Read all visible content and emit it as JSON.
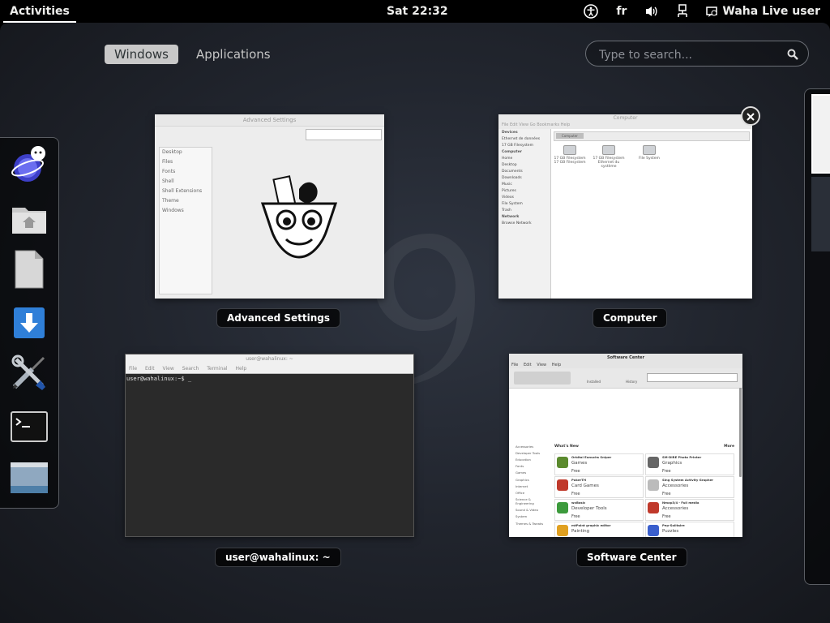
{
  "topbar": {
    "activities": "Activities",
    "clock": "Sat 22:32",
    "keyboard_layout": "fr",
    "user": "Waha Live user"
  },
  "view_switcher": {
    "windows": "Windows",
    "applications": "Applications"
  },
  "search": {
    "placeholder": "Type to search..."
  },
  "windows": {
    "advanced_settings": {
      "caption": "Advanced Settings",
      "title": "Advanced Settings",
      "sidebar": [
        "Desktop",
        "Files",
        "Fonts",
        "Shell",
        "Shell Extensions",
        "Theme",
        "Windows"
      ]
    },
    "computer": {
      "caption": "Computer",
      "title": "Computer",
      "menu": "File  Edit  View  Go  Bookmarks  Help",
      "path_button": "Computer",
      "sidebar": [
        {
          "text": "Devices",
          "h": true
        },
        {
          "text": "Ethernet de données",
          "h": false
        },
        {
          "text": "17 GB Filesystem",
          "h": false
        },
        {
          "text": "Computer",
          "h": true
        },
        {
          "text": "Home",
          "h": false
        },
        {
          "text": "Desktop",
          "h": false
        },
        {
          "text": "Documents",
          "h": false
        },
        {
          "text": "Downloads",
          "h": false
        },
        {
          "text": "Music",
          "h": false
        },
        {
          "text": "Pictures",
          "h": false
        },
        {
          "text": "Videos",
          "h": false
        },
        {
          "text": "File System",
          "h": false
        },
        {
          "text": "Trash",
          "h": false
        },
        {
          "text": "Network",
          "h": true
        },
        {
          "text": "Browse Network",
          "h": false
        }
      ],
      "drives": [
        {
          "label": "17 GB Filesystem 17 GB Filesystem"
        },
        {
          "label": "17 GB Filesystem Ethernet du système"
        },
        {
          "label": "File System"
        }
      ]
    },
    "terminal": {
      "caption": "user@wahalinux: ~",
      "title": "user@wahalinux: ~",
      "menu": [
        "File",
        "Edit",
        "View",
        "Search",
        "Terminal",
        "Help"
      ],
      "prompt": "user@wahalinux:~$ _"
    },
    "software_center": {
      "caption": "Software Center",
      "title": "Software Center",
      "menu": [
        "File",
        "Edit",
        "View",
        "Help"
      ],
      "toolbar": [
        "Installed",
        "History"
      ],
      "categories": [
        "Accessories",
        "Developer Tools",
        "Education",
        "Fonts",
        "Games",
        "Graphics",
        "Internet",
        "Office",
        "Science & Engineering",
        "Sound & Video",
        "System",
        "Themes & Tweaks"
      ],
      "whats_new": "What's New",
      "more": "More",
      "apps": [
        {
          "name": "Orbital Eunuchs Sniper",
          "category": "Games",
          "price": "Free",
          "color": "#5b8a2e"
        },
        {
          "name": "SM-DIRE Photo Printer",
          "category": "Graphics",
          "price": "Free",
          "color": "#666666"
        },
        {
          "name": "PokerTH",
          "category": "Card Games",
          "price": "Free",
          "color": "#c0392b"
        },
        {
          "name": "Sing System Activity Grapher",
          "category": "Accessories",
          "price": "Free",
          "color": "#bbbbbb"
        },
        {
          "name": "wxBasic",
          "category": "Developer Tools",
          "price": "Free",
          "color": "#3c9a3c"
        },
        {
          "name": "Nmap3/4 - Full media",
          "category": "Accessories",
          "price": "Free",
          "color": "#c0392b"
        },
        {
          "name": "mtPaint graphic editor",
          "category": "Painting",
          "price": "",
          "color": "#e0a020"
        },
        {
          "name": "Pep-Solitaire",
          "category": "Puzzles",
          "price": "",
          "color": "#3a5fcd"
        }
      ]
    }
  },
  "colors": {
    "accent": "#3465a4",
    "panel": "#000000"
  }
}
